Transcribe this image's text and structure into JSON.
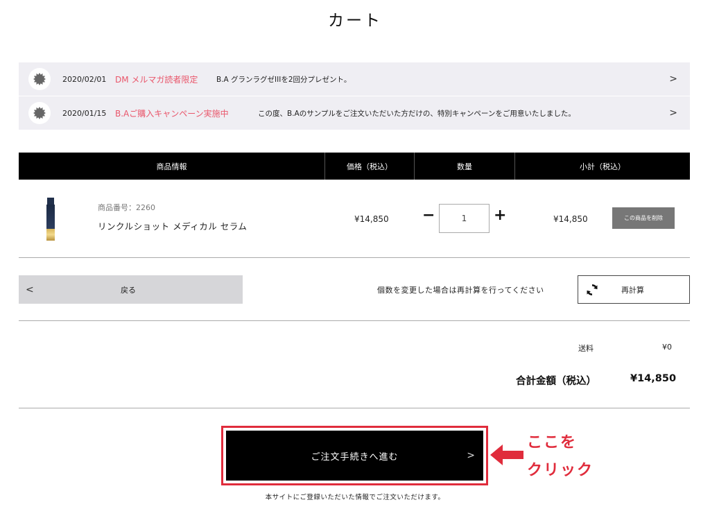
{
  "page": {
    "title": "カート"
  },
  "notices": [
    {
      "date": "2020/02/01",
      "tag": "DM メルマガ読者限定",
      "text": "B.A グランラグゼIIIを2回分プレゼント。"
    },
    {
      "date": "2020/01/15",
      "tag": "B.Aご購入キャンペーン実施中",
      "text": "この度、B.Aのサンプルをご注文いただいた方だけの、特別キャンペーンをご用意いたしました。"
    }
  ],
  "table": {
    "headers": {
      "info": "商品情報",
      "price": "価格（税込）",
      "quantity": "数量",
      "subtotal": "小計（税込）"
    },
    "items": [
      {
        "product_no": "商品番号：2260",
        "name": "リンクルショット メディカル セラム",
        "price": "¥14,850",
        "quantity": "1",
        "minus": "−",
        "plus": "+",
        "subtotal": "¥14,850",
        "delete_label": "この商品を削除"
      }
    ]
  },
  "actions": {
    "back_label": "戻る",
    "back_chevron": "<",
    "recalc_note": "個数を変更した場合は再計算を行ってください",
    "recalc_label": "再計算"
  },
  "summary": {
    "shipping_label": "送料",
    "shipping_value": "¥0",
    "total_label": "合計金額（税込）",
    "total_value": "¥14,850"
  },
  "checkout": {
    "label": "ご注文手続きへ進む",
    "chevron": ">",
    "note": "本サイトにご登録いただいた情報でご注文いただけます。"
  },
  "annotation": {
    "line1": "ここを",
    "line2": "クリック",
    "color": "#e02c3c"
  },
  "colors": {
    "notice_tag": "#e9556a",
    "notice_bg": "#efeef3",
    "header_bg": "#000000",
    "delete_bg": "#777777",
    "back_bg": "#d6d6d9",
    "checkout_bg": "#000000"
  },
  "icons": {
    "notice": "badge-burst-icon",
    "chevron": "chevron-right-icon",
    "recalc": "refresh-icon"
  }
}
